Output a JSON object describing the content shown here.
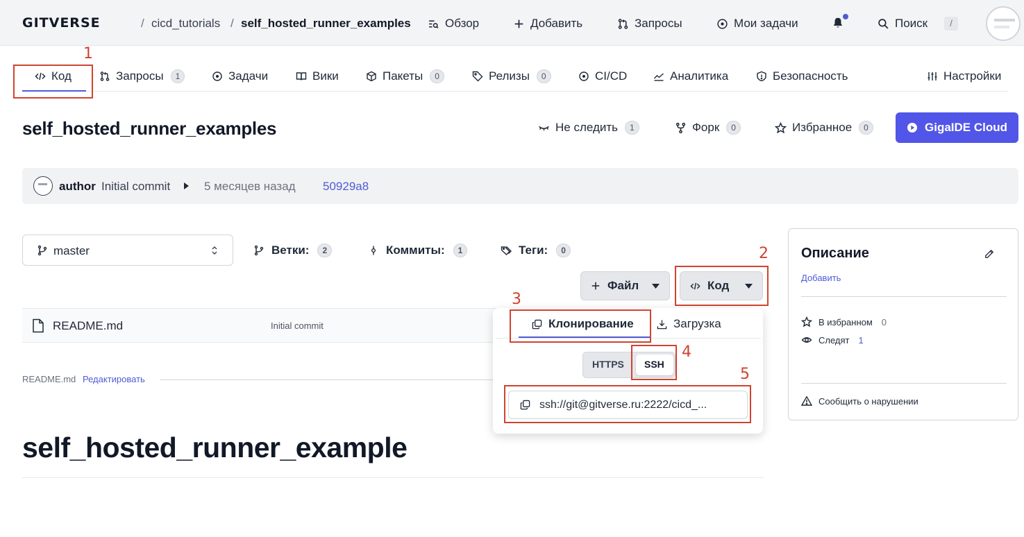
{
  "header": {
    "logo": "GITVERSE",
    "breadcrumb_owner": "cicd_tutorials",
    "breadcrumb_sep": "/",
    "breadcrumb_repo": "self_hosted_runner_examples",
    "nav": [
      {
        "label": "Обзор",
        "icon": "overview-icon"
      },
      {
        "label": "Добавить",
        "icon": "plus-icon"
      },
      {
        "label": "Запросы",
        "icon": "pull-request-icon"
      },
      {
        "label": "Мои задачи",
        "icon": "issue-icon"
      }
    ],
    "search_label": "Поиск",
    "search_shortcut": "/"
  },
  "tabs": [
    {
      "label": "Код",
      "count": null
    },
    {
      "label": "Запросы",
      "count": "1"
    },
    {
      "label": "Задачи",
      "count": null
    },
    {
      "label": "Вики",
      "count": null
    },
    {
      "label": "Пакеты",
      "count": "0"
    },
    {
      "label": "Релизы",
      "count": "0"
    },
    {
      "label": "CI/CD",
      "count": null
    },
    {
      "label": "Аналитика",
      "count": null
    },
    {
      "label": "Безопасность",
      "count": null
    },
    {
      "label": "Настройки",
      "count": null
    }
  ],
  "repo": {
    "title": "self_hosted_runner_examples",
    "watch_label": "Не следить",
    "watch_count": "1",
    "fork_label": "Форк",
    "fork_count": "0",
    "star_label": "Избранное",
    "star_count": "0",
    "ide_label": "GigaIDE Cloud"
  },
  "commit": {
    "author": "author",
    "message": "Initial commit",
    "time": "5 месяцев назад",
    "hash": "50929a8"
  },
  "branch": {
    "current": "master",
    "branches_label": "Ветки:",
    "branches_count": "2",
    "commits_label": "Коммиты:",
    "commits_count": "1",
    "tags_label": "Теги:",
    "tags_count": "0"
  },
  "buttons": {
    "file": "Файл",
    "code": "Код"
  },
  "files": [
    {
      "name": "README.md",
      "commit": "Initial commit"
    }
  ],
  "readme": {
    "label": "README.md",
    "edit": "Редактировать",
    "heading": "self_hosted_runner_example"
  },
  "dropdown": {
    "tab_clone": "Клонирование",
    "tab_download": "Загрузка",
    "proto_https": "HTTPS",
    "proto_ssh": "SSH",
    "selected_proto": "SSH",
    "url": "ssh://git@gitverse.ru:2222/cicd_..."
  },
  "sidebar": {
    "title": "Описание",
    "add": "Добавить",
    "favorites_label": "В избранном",
    "favorites_count": "0",
    "watchers_label": "Следят",
    "watchers_count": "1",
    "report": "Сообщить о нарушении"
  },
  "annotations": [
    "1",
    "2",
    "3",
    "4",
    "5"
  ],
  "colors": {
    "accent": "#4f5bd5",
    "ide_button": "#5156e8",
    "annotation": "#d0432f"
  }
}
